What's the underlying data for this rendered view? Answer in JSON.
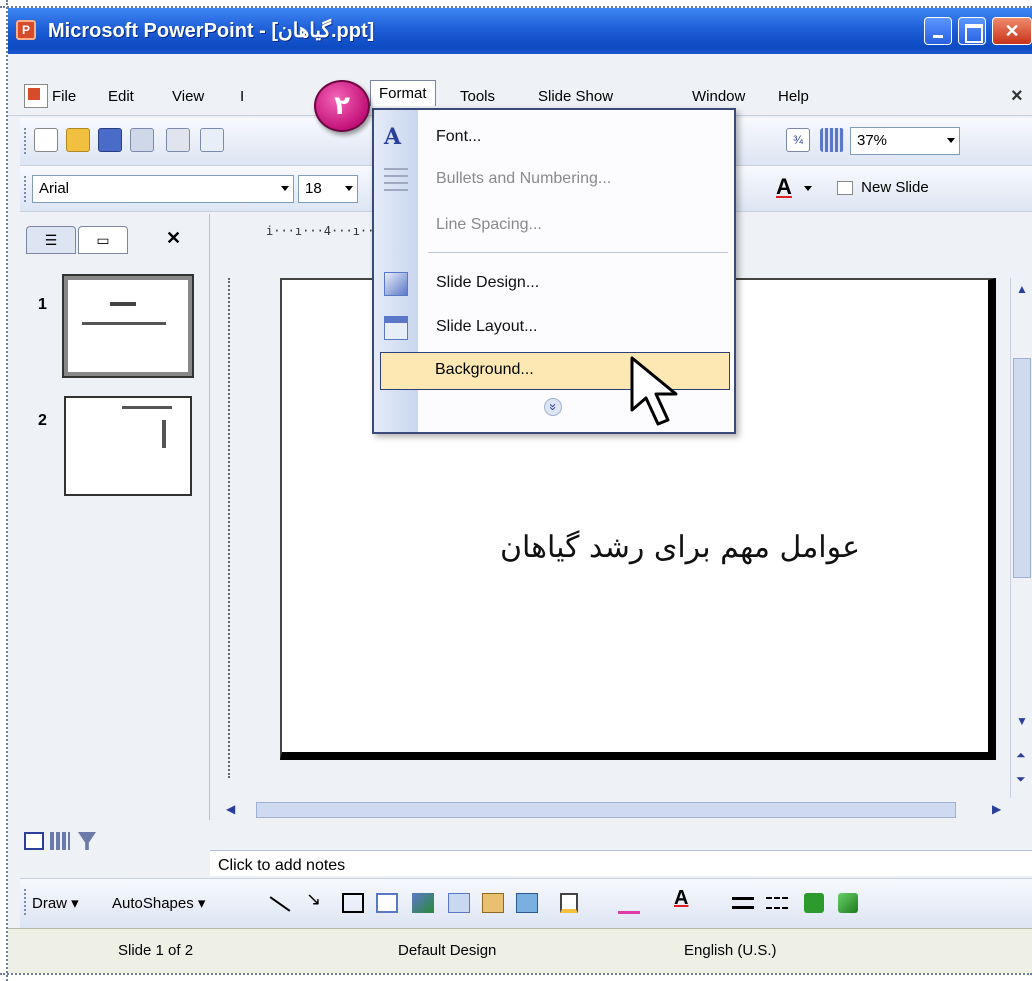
{
  "window": {
    "title": "Microsoft PowerPoint - [گیاهان.ppt]"
  },
  "menubar": {
    "items": [
      "File",
      "Edit",
      "View",
      "I",
      "Format",
      "Tools",
      "Slide Show",
      "Window",
      "Help"
    ],
    "close_glyph": "×"
  },
  "toolbar": {
    "zoom": "37%",
    "font_name": "Arial",
    "font_size": "18",
    "new_slide_label": "New Slide"
  },
  "format_menu": {
    "items": [
      {
        "label": "Font...",
        "enabled": true,
        "icon": "font-a-icon"
      },
      {
        "label": "Bullets and Numbering...",
        "enabled": false,
        "icon": "bullets-icon"
      },
      {
        "label": "Line Spacing...",
        "enabled": false,
        "icon": ""
      },
      {
        "label": "Slide Design...",
        "enabled": true,
        "icon": "slide-design-icon"
      },
      {
        "label": "Slide Layout...",
        "enabled": true,
        "icon": "slide-layout-icon"
      },
      {
        "label": "Background...",
        "enabled": true,
        "highlighted": true,
        "icon": ""
      }
    ],
    "expand_glyph": "»"
  },
  "badge": {
    "text": "۲"
  },
  "slides_panel": {
    "thumbnails": [
      {
        "number": "1",
        "selected": true
      },
      {
        "number": "2",
        "selected": false
      }
    ]
  },
  "slide": {
    "text": "عوامل مهم برای رشد گیاهان"
  },
  "ruler": {
    "horizontal": "i···ı···4···ı······················ı···2···ı···3···ı···4···ı····"
  },
  "notes": {
    "placeholder": "Click to add notes"
  },
  "draw_toolbar": {
    "draw_label": "Draw",
    "autoshapes_label": "AutoShapes"
  },
  "statusbar": {
    "slide_info": "Slide 1 of 2",
    "design": "Default Design",
    "language": "English (U.S.)"
  },
  "colors": {
    "titlebar": "#1f5fd8",
    "badge": "#c4127a",
    "menu_highlight": "#fde8b4"
  }
}
